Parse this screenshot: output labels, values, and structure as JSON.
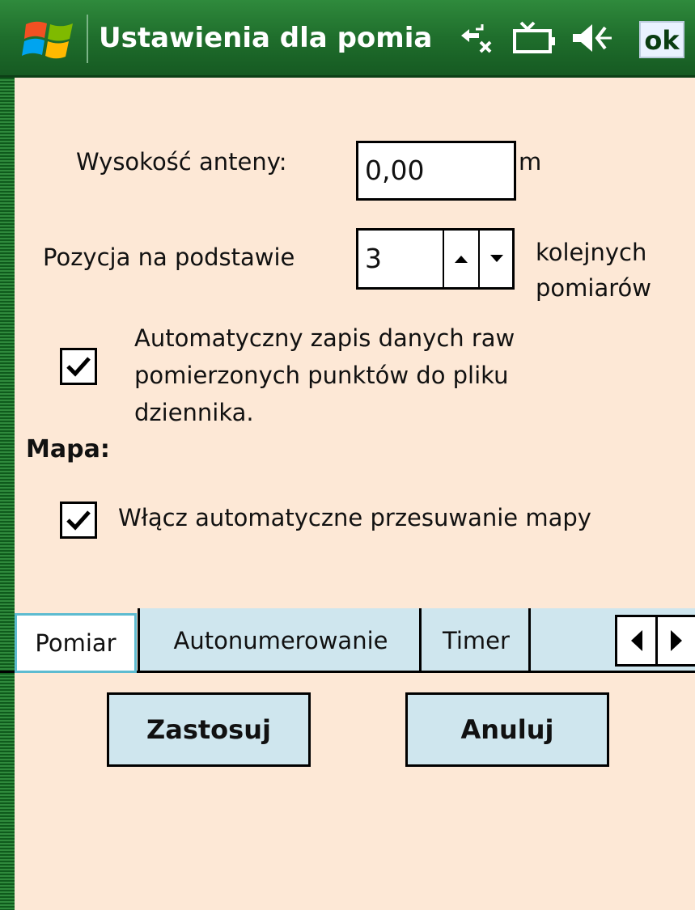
{
  "window": {
    "title": "Ustawienia dla pomia",
    "ok_label": "ok",
    "icons": [
      "windows-logo-icon",
      "connectivity-icon",
      "battery-icon",
      "speaker-icon"
    ]
  },
  "form": {
    "antenna_label": "Wysokość anteny:",
    "antenna_value": "0,00",
    "antenna_unit": "m",
    "position_label": "Pozycja na podstawie",
    "position_value": "3",
    "position_suffix_line1": "kolejnych",
    "position_suffix_line2": "pomiarów",
    "raw_checkbox_checked": true,
    "raw_label_line1": "Automatyczny zapis danych raw",
    "raw_label_line2": "pomierzonych punktów do pliku",
    "raw_label_line3": "dziennika.",
    "map_heading": "Mapa:",
    "map_checkbox_checked": true,
    "map_label": "Włącz automatyczne przesuwanie mapy"
  },
  "tabs": [
    {
      "label": "Pomiar",
      "active": true
    },
    {
      "label": "Autonumerowanie",
      "active": false
    },
    {
      "label": "Timer",
      "active": false
    }
  ],
  "buttons": {
    "apply": "Zastosuj",
    "cancel": "Anuluj"
  },
  "colors": {
    "background": "#fde8d6",
    "titlebar": "#1f6e2c",
    "button_face": "#cfe6ee",
    "active_tab_border": "#5dbbd0"
  }
}
